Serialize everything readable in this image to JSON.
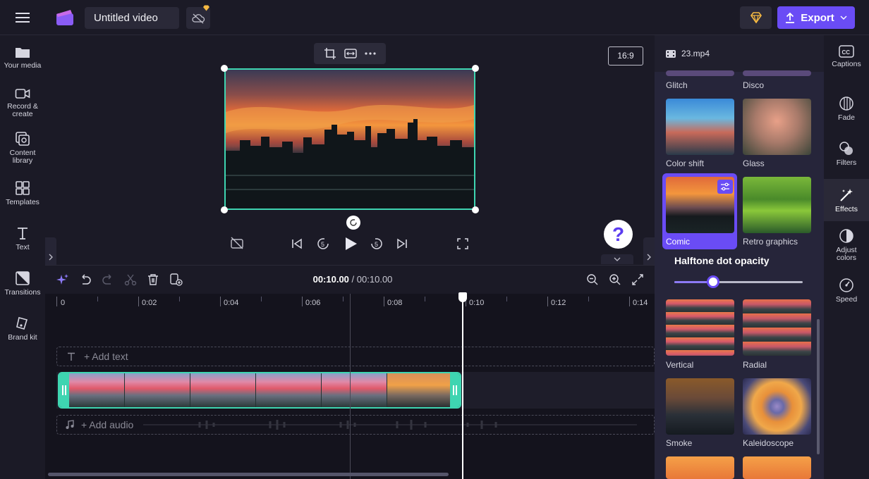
{
  "header": {
    "project_title": "Untitled video",
    "export_label": "Export"
  },
  "left_sidebar": {
    "items": [
      {
        "label": "Your media",
        "icon": "folder-icon"
      },
      {
        "label": "Record & create",
        "icon": "video-camera-icon"
      },
      {
        "label": "Content library",
        "icon": "content-library-icon"
      },
      {
        "label": "Templates",
        "icon": "templates-icon"
      },
      {
        "label": "Text",
        "icon": "text-icon"
      },
      {
        "label": "Transitions",
        "icon": "transitions-icon"
      },
      {
        "label": "Brand kit",
        "icon": "brand-kit-icon"
      }
    ]
  },
  "preview": {
    "aspect_ratio": "16:9"
  },
  "timeline": {
    "current_time": "00:10.00",
    "separator": "/",
    "total_time": "00:10.00",
    "ruler_labels": [
      "0",
      "0:02",
      "0:04",
      "0:06",
      "0:08",
      "0:10",
      "0:12",
      "0:14"
    ],
    "add_text_label": "+ Add text",
    "add_audio_label": "+ Add audio"
  },
  "right_panel": {
    "file_name": "23.mp4",
    "effects": [
      {
        "label": "Glitch"
      },
      {
        "label": "Disco"
      },
      {
        "label": "Color shift"
      },
      {
        "label": "Glass"
      },
      {
        "label": "Comic",
        "selected": true
      },
      {
        "label": "Retro graphics"
      },
      {
        "label": "Vertical"
      },
      {
        "label": "Radial"
      },
      {
        "label": "Smoke"
      },
      {
        "label": "Kaleidoscope"
      }
    ],
    "slider_title": "Halftone dot opacity",
    "slider_value": 0.3
  },
  "right_toolbar": {
    "items": [
      {
        "label": "Captions",
        "icon": "captions-icon"
      },
      {
        "label": "Fade",
        "icon": "fade-icon"
      },
      {
        "label": "Filters",
        "icon": "filters-icon"
      },
      {
        "label": "Effects",
        "icon": "effects-wand-icon",
        "active": true
      },
      {
        "label": "Adjust colors",
        "icon": "adjust-colors-icon"
      },
      {
        "label": "Speed",
        "icon": "speed-icon"
      }
    ]
  },
  "colors": {
    "accent": "#6a4cf5",
    "selection": "#3ed5b1",
    "background": "#1b1a26"
  }
}
